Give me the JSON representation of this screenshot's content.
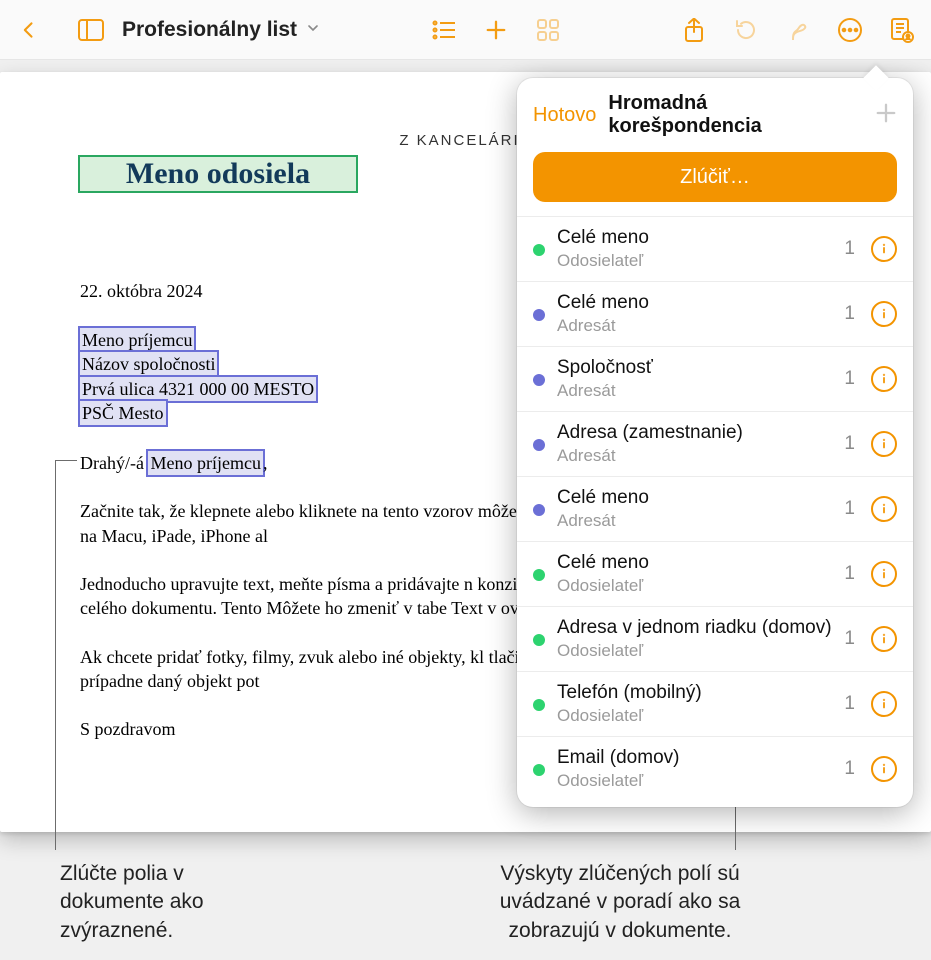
{
  "toolbar": {
    "doc_title": "Profesionálny list"
  },
  "document": {
    "eyebrow": "Z KANCELÁRIE",
    "sender_name": "Meno odosiela",
    "date": "22. októbra 2024",
    "recipient": {
      "name": "Meno príjemcu",
      "company": "Názov spoločnosti",
      "street": "Prvá ulica 4321 000 00 MESTO",
      "city": "PSČ  Mesto"
    },
    "salutation_prefix": "Drahý/-á ",
    "salutation_field": "Meno príjemcu",
    "salutation_suffix": ",",
    "p1": "Začnite tak, že klepnete alebo kliknete na tento vzorov môžete zobraziť a upravovať na Macu, iPade, iPhone al",
    "p2": "Jednoducho upravujte text, meňte písma a pridávajte n konzistentný vzhľad v rámci celého dokumentu. Tento Môžete ho zmeniť v tabe Text v ovládacích prvkoch Fo",
    "p3": "Ak chcete pridať fotky, filmy, zvuk alebo iné objekty, kl tlačidiel v paneli s nástrojmi, prípadne daný objekt pot",
    "closing": "S pozdravom"
  },
  "panel": {
    "done": "Hotovo",
    "title": "Hromadná korešpondencia",
    "merge_btn": "Zlúčiť…",
    "fields": [
      {
        "label": "Celé meno",
        "source": "Odosielateľ",
        "count": "1",
        "color": "green"
      },
      {
        "label": "Celé meno",
        "source": "Adresát",
        "count": "1",
        "color": "purple"
      },
      {
        "label": "Spoločnosť",
        "source": "Adresát",
        "count": "1",
        "color": "purple"
      },
      {
        "label": "Adresa (zamestnanie)",
        "source": "Adresát",
        "count": "1",
        "color": "purple"
      },
      {
        "label": "Celé meno",
        "source": "Adresát",
        "count": "1",
        "color": "purple"
      },
      {
        "label": "Celé meno",
        "source": "Odosielateľ",
        "count": "1",
        "color": "green"
      },
      {
        "label": "Adresa v jednom riadku (domov)",
        "source": "Odosielateľ",
        "count": "1",
        "color": "green"
      },
      {
        "label": "Telefón (mobilný)",
        "source": "Odosielateľ",
        "count": "1",
        "color": "green"
      },
      {
        "label": "Email (domov)",
        "source": "Odosielateľ",
        "count": "1",
        "color": "green"
      }
    ]
  },
  "annotations": {
    "left": "Zlúčte polia v dokumente ako zvýraznené.",
    "right": "Výskyty zlúčených polí sú uvádzané v poradí ako sa zobrazujú v dokumente."
  }
}
